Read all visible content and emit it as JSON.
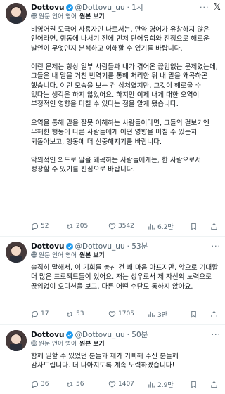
{
  "tweets": [
    {
      "name": "Dottovu",
      "handle": "@Dottovu_uu",
      "time": "· 1시",
      "trans_label": "원문 언어 영어",
      "orig_link": "원본 보기",
      "body": "비영어권 모국어 사용자인 나로서는, 만약 영어가 유창하지 않은 언어라면, 행동에 나서기 전에 먼저 단어유희와 진정으로 해로운 발언이 무엇인지 분석하고 이해할 수 있기를 바랍니다.\n\n이런 문제는 항상 일부 사람들과 내가 겪어온 끊임없는 문제였는데, 그들은 내 말을 거친 번역기를 통해 처리한 뒤 내 말을 왜곡하곤 했습니다. 이런 모습을 보는 건 상처였지만, 그것이 해로울 수 있다는 생각은 하지 않았어요. 하지만 이제 내게 대한 오역이 부정적인 영향을 미칠 수 있다는 점을 알게 됐습니다.\n\n오역을 통해 말을 잘못 이해하는 사람들이라면, 그들의 걸보기엔 무해한 행동이 다른 사람들에게 어떤 영향을 미칠 수 있는지 되돌아보고, 행동에 더 신중해지기를 바랍니다.\n\n악의적인 의도로 말을 왜곡하는 사람들에게는, 한 사람으로서 성장할 수 있기를 진심으로 바랍니다.",
      "replies": "52",
      "retweets": "205",
      "likes": "3542",
      "views": "6.2만"
    },
    {
      "name": "Dottovu",
      "handle": "@Dottovu_uu",
      "time": "· 53분",
      "trans_label": "원문 언어 영어",
      "orig_link": "원본 보기",
      "body": "솔직히 말해서, 이 기회를 놓친 건 꽤 마음 아프지만, 앞으로 기대할 더 많은 프로젝트들이 있어요. 저는 성우로서 제 자신의 노력으로 끊임없이 오디션을 보고, 다른 어떤 수단도 통하지 않아요.",
      "replies": "17",
      "retweets": "53",
      "likes": "1705",
      "views": "3만"
    },
    {
      "name": "Dottovu",
      "handle": "@Dottovu_uu",
      "time": "· 50분",
      "trans_label": "원문 언어 영어",
      "orig_link": "원본 보기",
      "body": "함께 일할 수 있었던 분들과 제가 기뻐해 주신 분들께 감사드립니다. 더 나아지도록 계속 노력하겠습니다!",
      "replies": "36",
      "retweets": "56",
      "likes": "1407",
      "views": "2.9만"
    }
  ],
  "colors": {
    "text": "#0f1419",
    "muted": "#536471",
    "verified": "#1d9bf0",
    "divider": "#eff3f4"
  },
  "icons": [
    "x-logo-icon",
    "more-icon",
    "verified-icon",
    "globe-icon",
    "reply-icon",
    "retweet-icon",
    "like-icon",
    "views-icon",
    "bookmark-icon",
    "share-icon"
  ]
}
